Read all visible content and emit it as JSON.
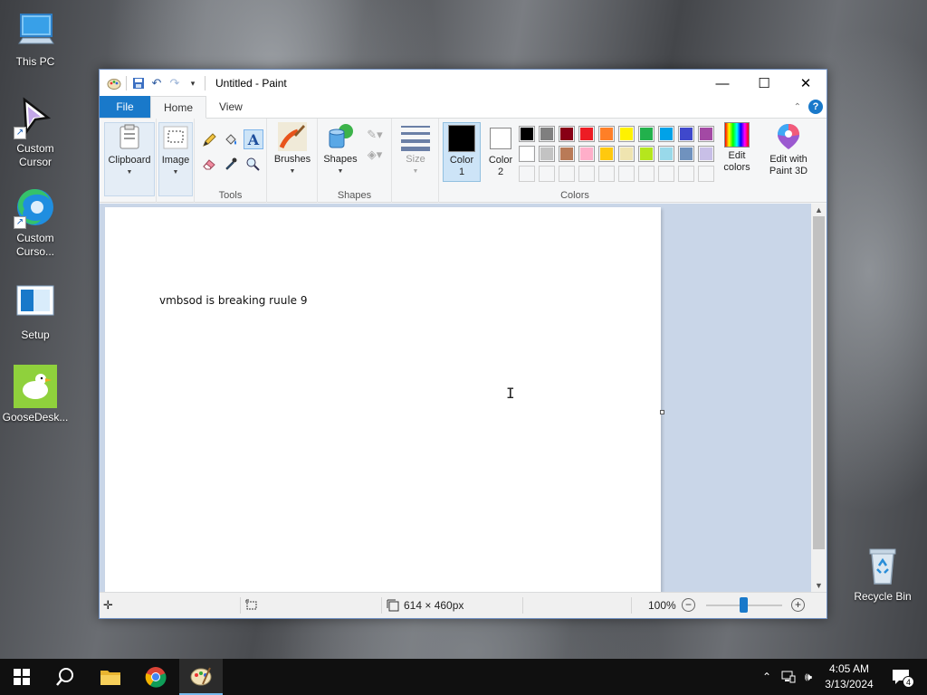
{
  "desktop": {
    "icons": [
      {
        "label": "This PC",
        "icon": "computer-icon"
      },
      {
        "label": "Custom\nCursor",
        "icon": "cursor-arrow-icon"
      },
      {
        "label": "Custom\nCurso...",
        "icon": "edge-icon"
      },
      {
        "label": "Setup",
        "icon": "setup-icon"
      },
      {
        "label": "GooseDesk...",
        "icon": "goose-icon"
      },
      {
        "label": "Recycle Bin",
        "icon": "recycle-bin-icon"
      }
    ]
  },
  "window": {
    "title": "Untitled - Paint",
    "controls": {
      "minimize": "—",
      "maximize": "☐",
      "close": "✕"
    }
  },
  "tabs": [
    {
      "label": "File"
    },
    {
      "label": "Home"
    },
    {
      "label": "View"
    }
  ],
  "ribbon": {
    "clipboard": {
      "label": "Clipboard"
    },
    "image": {
      "label": "Image"
    },
    "tools": {
      "label": "Tools"
    },
    "brushes": {
      "label": "Brushes"
    },
    "shapes": {
      "button_label": "Shapes",
      "group_label": "Shapes"
    },
    "size": {
      "label": "Size"
    },
    "color1": {
      "label_line1": "Color",
      "label_line2": "1",
      "value": "#000000"
    },
    "color2": {
      "label_line1": "Color",
      "label_line2": "2",
      "value": "#ffffff"
    },
    "colors_group_label": "Colors",
    "edit_colors": {
      "line1": "Edit",
      "line2": "colors"
    },
    "edit_paint3d": {
      "line1": "Edit with",
      "line2": "Paint 3D"
    },
    "palette_row1": [
      "#000000",
      "#7f7f7f",
      "#880015",
      "#ed1c24",
      "#ff7f27",
      "#fff200",
      "#22b14c",
      "#00a2e8",
      "#3f48cc",
      "#a349a4"
    ],
    "palette_row2": [
      "#ffffff",
      "#c3c3c3",
      "#b97a57",
      "#ffaec9",
      "#ffc90e",
      "#efe4b0",
      "#b5e61d",
      "#99d9ea",
      "#7092be",
      "#c8bfe7"
    ]
  },
  "canvas": {
    "text": "vmbsod is breaking ruule 9"
  },
  "statusbar": {
    "dimensions": "614 × 460px",
    "zoom": "100%",
    "zoom_level": 1.0
  },
  "taskbar": {
    "time": "4:05 AM",
    "date": "3/13/2024",
    "notification_count": "4"
  }
}
